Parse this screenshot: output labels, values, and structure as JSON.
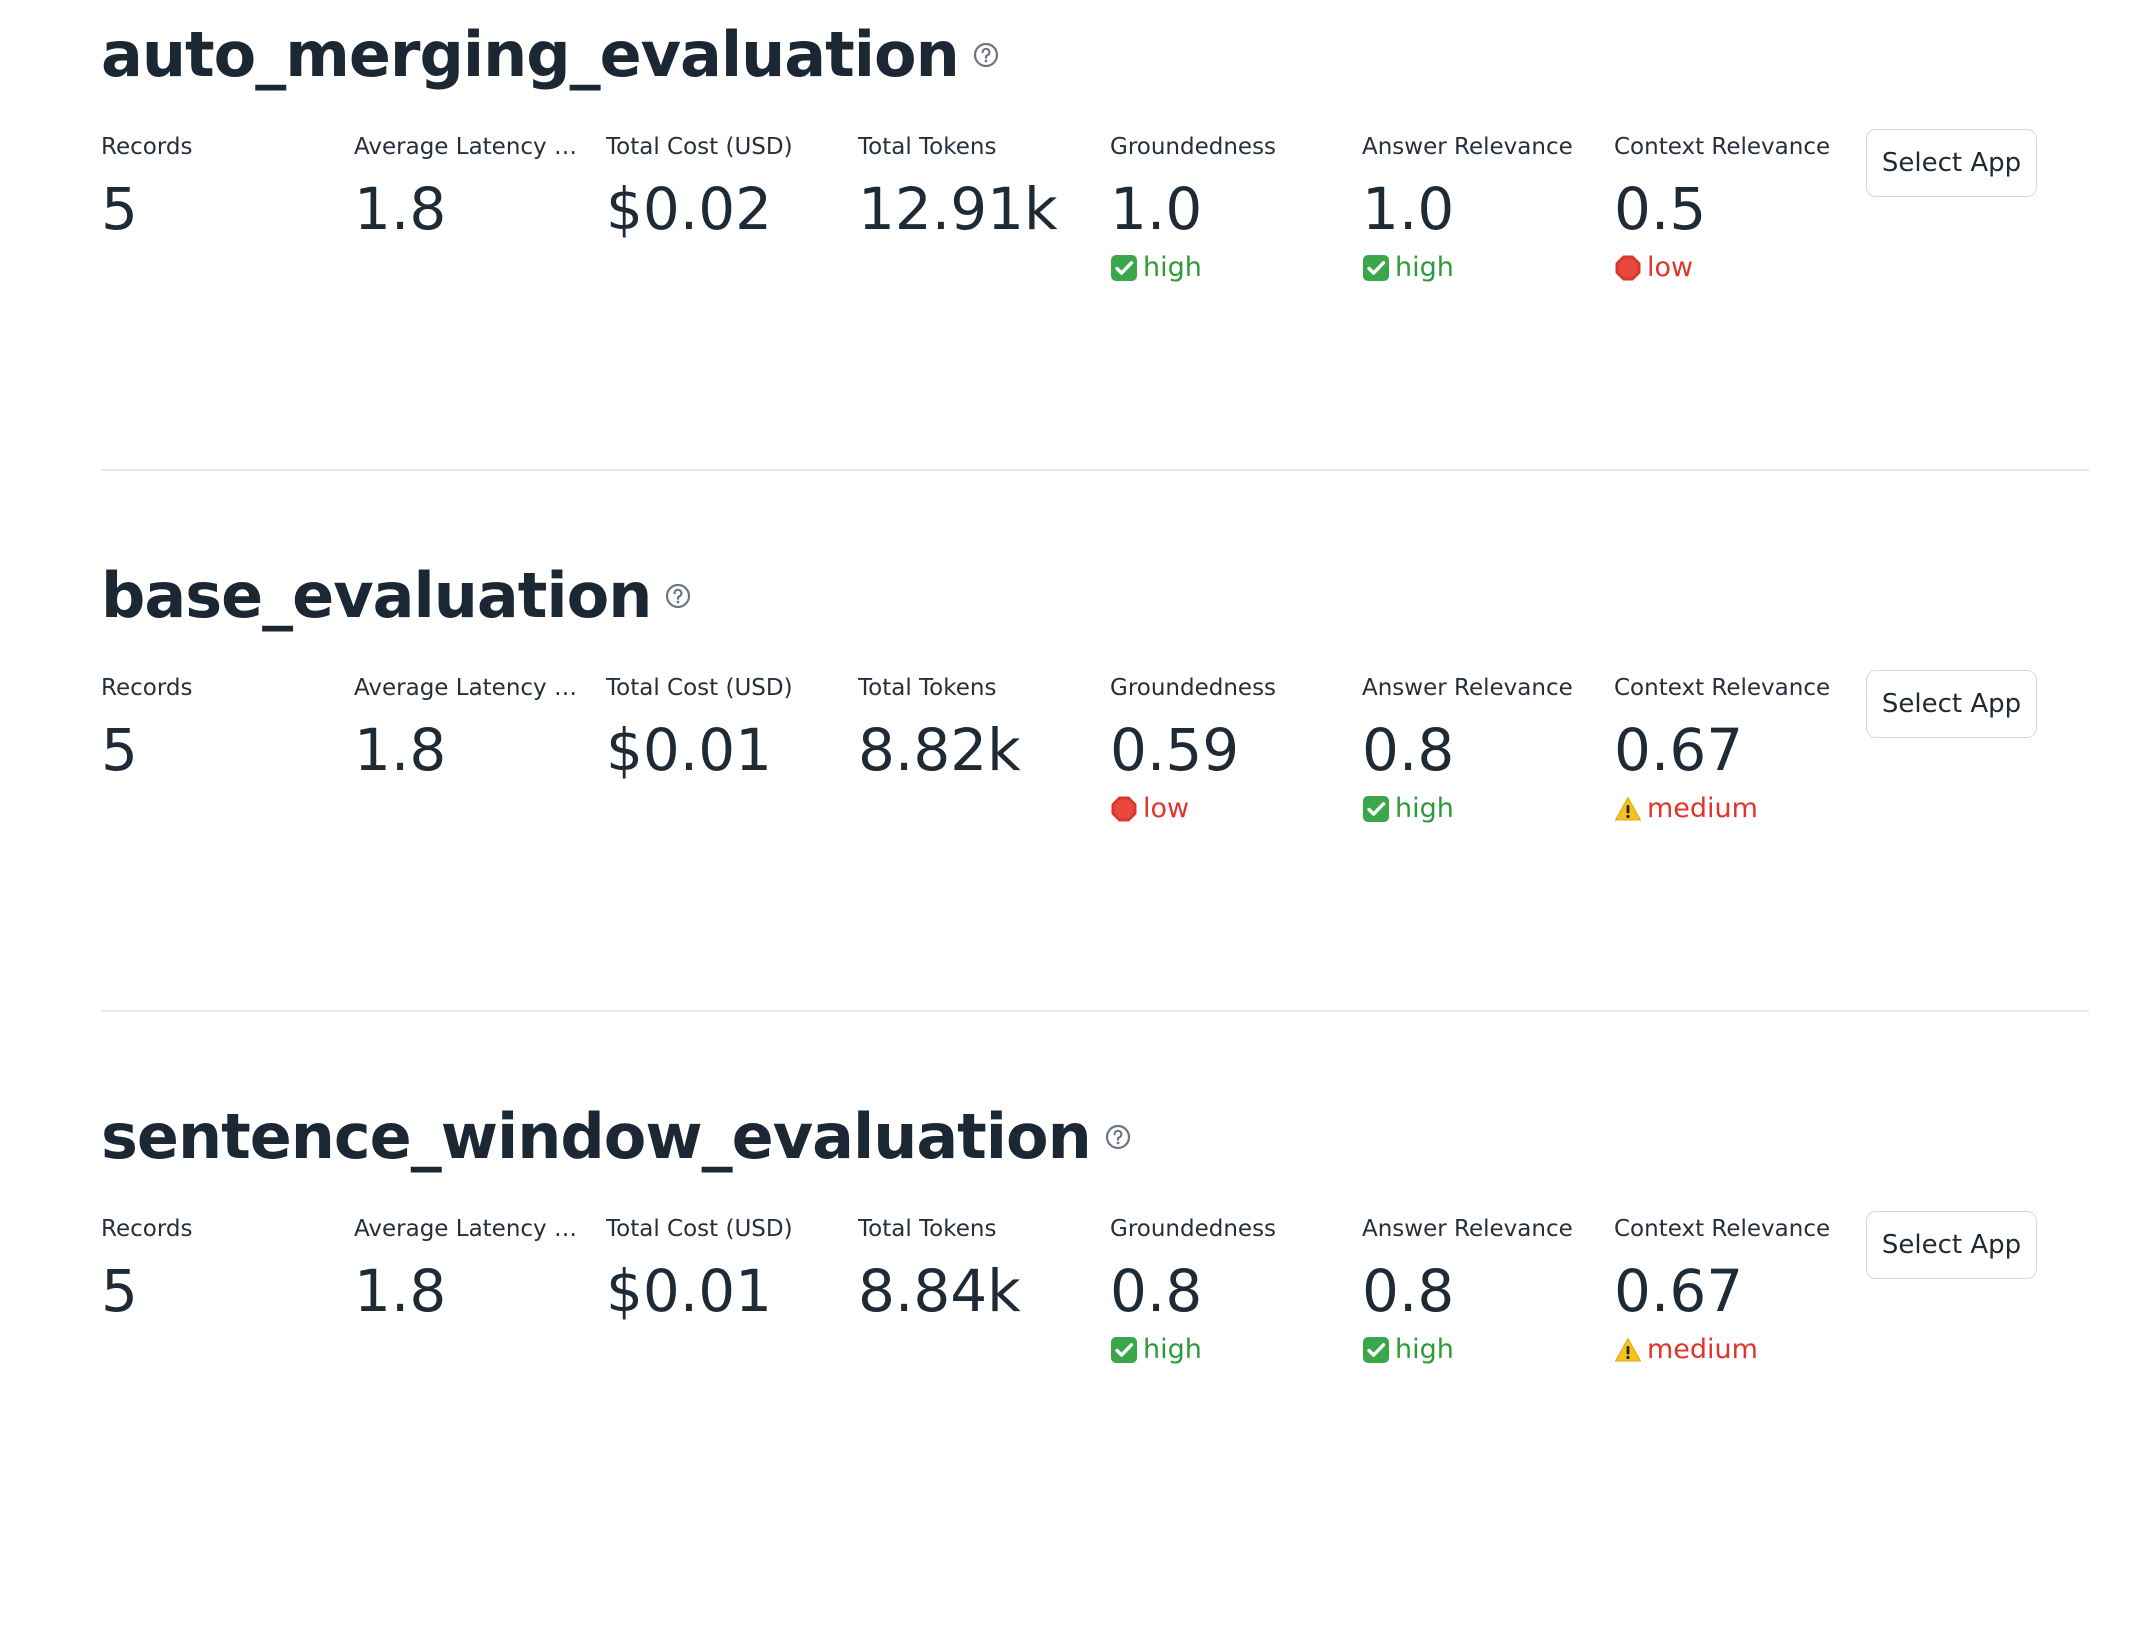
{
  "colors": {
    "high": "#2f9a3a",
    "low": "#e0352b",
    "medium": "#e0352b"
  },
  "icons": {
    "high": "check-mark-icon",
    "low": "stop-sign-icon",
    "medium": "warning-icon",
    "help": "question-circle-icon"
  },
  "apps": [
    {
      "name": "auto_merging_evaluation",
      "button_label": "Select App",
      "metrics": [
        {
          "label": "Records",
          "value": "5"
        },
        {
          "label": "Average Latency (Seconds)",
          "value": "1.8"
        },
        {
          "label": "Total Cost (USD)",
          "value": "$0.02"
        },
        {
          "label": "Total Tokens",
          "value": "12.91k"
        },
        {
          "label": "Groundedness",
          "value": "1.0",
          "status": "high"
        },
        {
          "label": "Answer Relevance",
          "value": "1.0",
          "status": "high"
        },
        {
          "label": "Context Relevance",
          "value": "0.5",
          "status": "low"
        }
      ]
    },
    {
      "name": "base_evaluation",
      "button_label": "Select App",
      "metrics": [
        {
          "label": "Records",
          "value": "5"
        },
        {
          "label": "Average Latency (Seconds)",
          "value": "1.8"
        },
        {
          "label": "Total Cost (USD)",
          "value": "$0.01"
        },
        {
          "label": "Total Tokens",
          "value": "8.82k"
        },
        {
          "label": "Groundedness",
          "value": "0.59",
          "status": "low"
        },
        {
          "label": "Answer Relevance",
          "value": "0.8",
          "status": "high"
        },
        {
          "label": "Context Relevance",
          "value": "0.67",
          "status": "medium"
        }
      ]
    },
    {
      "name": "sentence_window_evaluation",
      "button_label": "Select App",
      "metrics": [
        {
          "label": "Records",
          "value": "5"
        },
        {
          "label": "Average Latency (Seconds)",
          "value": "1.8"
        },
        {
          "label": "Total Cost (USD)",
          "value": "$0.01"
        },
        {
          "label": "Total Tokens",
          "value": "8.84k"
        },
        {
          "label": "Groundedness",
          "value": "0.8",
          "status": "high"
        },
        {
          "label": "Answer Relevance",
          "value": "0.8",
          "status": "high"
        },
        {
          "label": "Context Relevance",
          "value": "0.67",
          "status": "medium"
        }
      ]
    }
  ]
}
